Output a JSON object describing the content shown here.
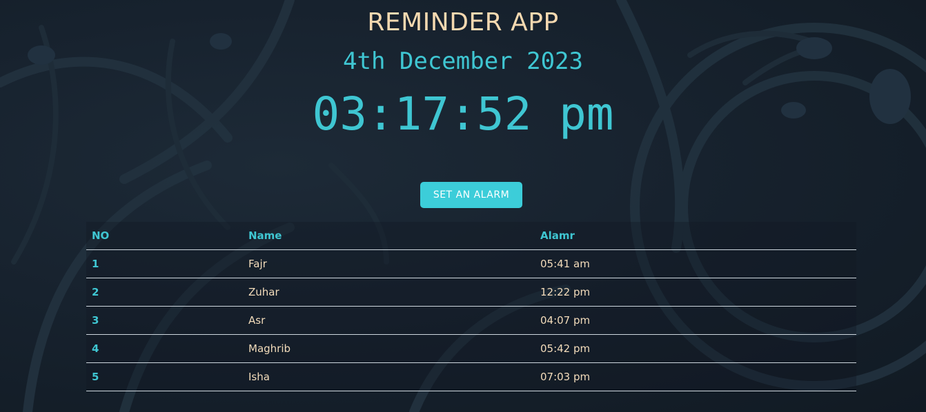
{
  "app": {
    "title": "REMINDER APP",
    "date": "4th December 2023",
    "time": "03:17:52 pm"
  },
  "actions": {
    "set_alarm_label": "SET AN ALARM"
  },
  "table": {
    "headers": {
      "no": "NO",
      "name": "Name",
      "alarm": "Alamr"
    },
    "rows": [
      {
        "no": "1",
        "name": "Fajr",
        "alarm": "05:41 am"
      },
      {
        "no": "2",
        "name": "Zuhar",
        "alarm": "12:22 pm"
      },
      {
        "no": "3",
        "name": "Asr",
        "alarm": "04:07 pm"
      },
      {
        "no": "4",
        "name": "Maghrib",
        "alarm": "05:42 pm"
      },
      {
        "no": "5",
        "name": "Isha",
        "alarm": "07:03 pm"
      }
    ]
  },
  "colors": {
    "accent": "#3fc6d2",
    "button": "#3ccdd9",
    "title": "#f5d9b0",
    "text": "#f3dcbb",
    "background": "#17222e"
  }
}
